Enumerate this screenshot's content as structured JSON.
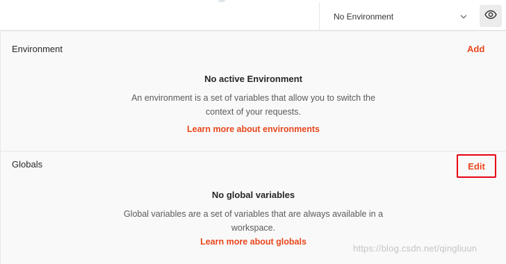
{
  "header": {
    "environment_select": {
      "selected": "No Environment"
    },
    "icons": {
      "dropdown": "chevron-down-icon",
      "quick_look": "eye-icon"
    }
  },
  "environment": {
    "title": "Environment",
    "action_label": "Add",
    "empty_title": "No active Environment",
    "empty_description": "An environment is a set of variables that allow you to switch the context of your requests.",
    "learn_more": "Learn more about environments"
  },
  "globals": {
    "title": "Globals",
    "action_label": "Edit",
    "empty_title": "No global variables",
    "empty_description": "Global variables are a set of variables that are always available in a workspace.",
    "learn_more": "Learn more about globals"
  },
  "watermark": "https://blog.csdn.net/qingliuun",
  "colors": {
    "accent": "#e8461c",
    "highlight_box": "#e60012",
    "panel_background": "#f9f9f9"
  }
}
